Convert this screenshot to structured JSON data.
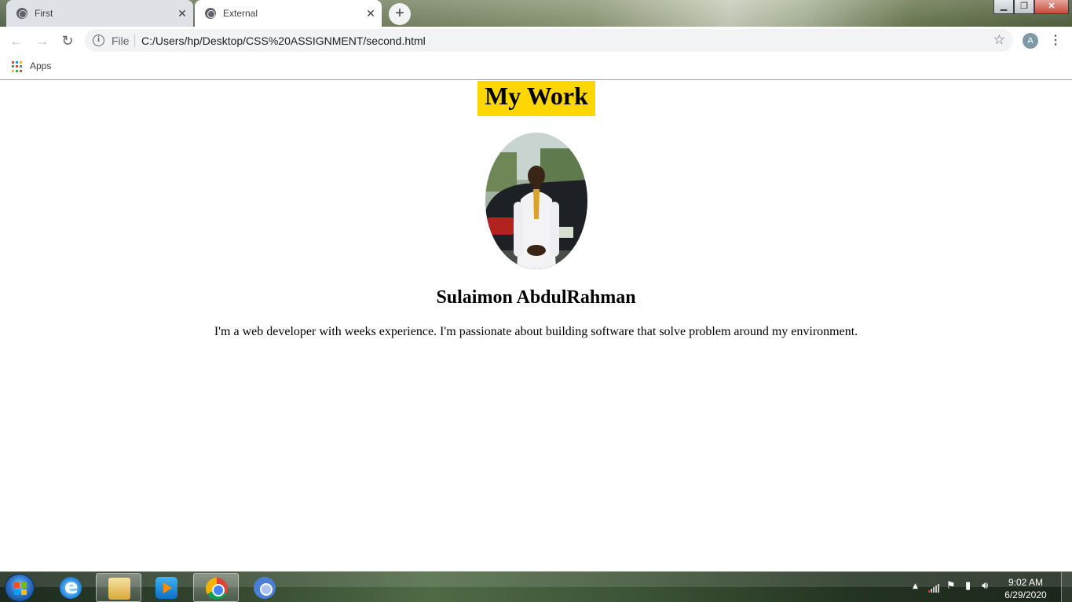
{
  "browser": {
    "tabs": [
      {
        "title": "First",
        "active": false
      },
      {
        "title": "External",
        "active": true
      }
    ],
    "new_tab_symbol": "+",
    "omnibox": {
      "security_label": "File",
      "url": "C:/Users/hp/Desktop/CSS%20ASSIGNMENT/second.html"
    },
    "profile_initial": "A",
    "bookmarks": {
      "apps_label": "Apps"
    }
  },
  "page": {
    "heading": "My Work",
    "heading_bg": "#ffd700",
    "name": "Sulaimon AbdulRahman",
    "bio": "I'm a web developer with weeks experience. I'm passionate about building software that solve problem around my environment."
  },
  "taskbar": {
    "apps": [
      {
        "icon": "internet-explorer-icon",
        "active": false
      },
      {
        "icon": "file-explorer-icon",
        "active": true
      },
      {
        "icon": "media-player-icon",
        "active": false
      },
      {
        "icon": "chrome-icon",
        "active": true
      },
      {
        "icon": "chrome-canary-icon",
        "active": false
      }
    ],
    "clock": {
      "time": "9:02 AM",
      "date": "6/29/2020"
    }
  }
}
